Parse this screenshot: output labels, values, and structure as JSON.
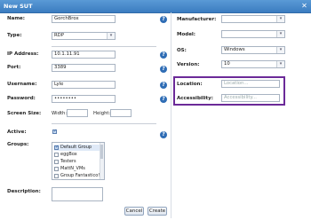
{
  "window": {
    "title": "New SUT",
    "close_glyph": "✕",
    "help_glyph": "?"
  },
  "left": {
    "name": {
      "label": "Name:",
      "value": "GorchBrox"
    },
    "type": {
      "label": "Type:",
      "value": "RDP"
    },
    "ip_address": {
      "label": "IP Address:",
      "value": "10.1.11.91"
    },
    "port": {
      "label": "Port:",
      "value": "3389"
    },
    "username": {
      "label": "Username:",
      "value": "Lyle"
    },
    "password": {
      "label": "Password:",
      "value": "••••••••"
    },
    "screen_size": {
      "label": "Screen Size:",
      "width_label": "Width:",
      "height_label": "Height:",
      "width_value": "",
      "height_value": ""
    },
    "active": {
      "label": "Active:",
      "checked": true
    },
    "groups": {
      "label": "Groups:",
      "items": [
        {
          "label": "Default Group",
          "checked": true
        },
        {
          "label": "eggBox",
          "checked": false
        },
        {
          "label": "Testers",
          "checked": false
        },
        {
          "label": "MattN_VMs",
          "checked": false
        },
        {
          "label": "Group Fantastico!",
          "checked": false
        }
      ]
    },
    "description": {
      "label": "Description:",
      "value": ""
    }
  },
  "right": {
    "manufacturer": {
      "label": "Manufacturer:",
      "value": ""
    },
    "model": {
      "label": "Model:",
      "value": ""
    },
    "os": {
      "label": "OS:",
      "value": "Windows"
    },
    "version": {
      "label": "Version:",
      "value": "10"
    },
    "location": {
      "label": "Location:",
      "placeholder": "Location..."
    },
    "accessibility": {
      "label": "Accessibility:",
      "placeholder": "Accessibility..."
    }
  },
  "buttons": {
    "cancel": "Cancel",
    "create": "Create"
  },
  "colors": {
    "titlebar": "#3b7cc0",
    "help_icon": "#2f6db5",
    "highlight": "#6b2a98"
  }
}
